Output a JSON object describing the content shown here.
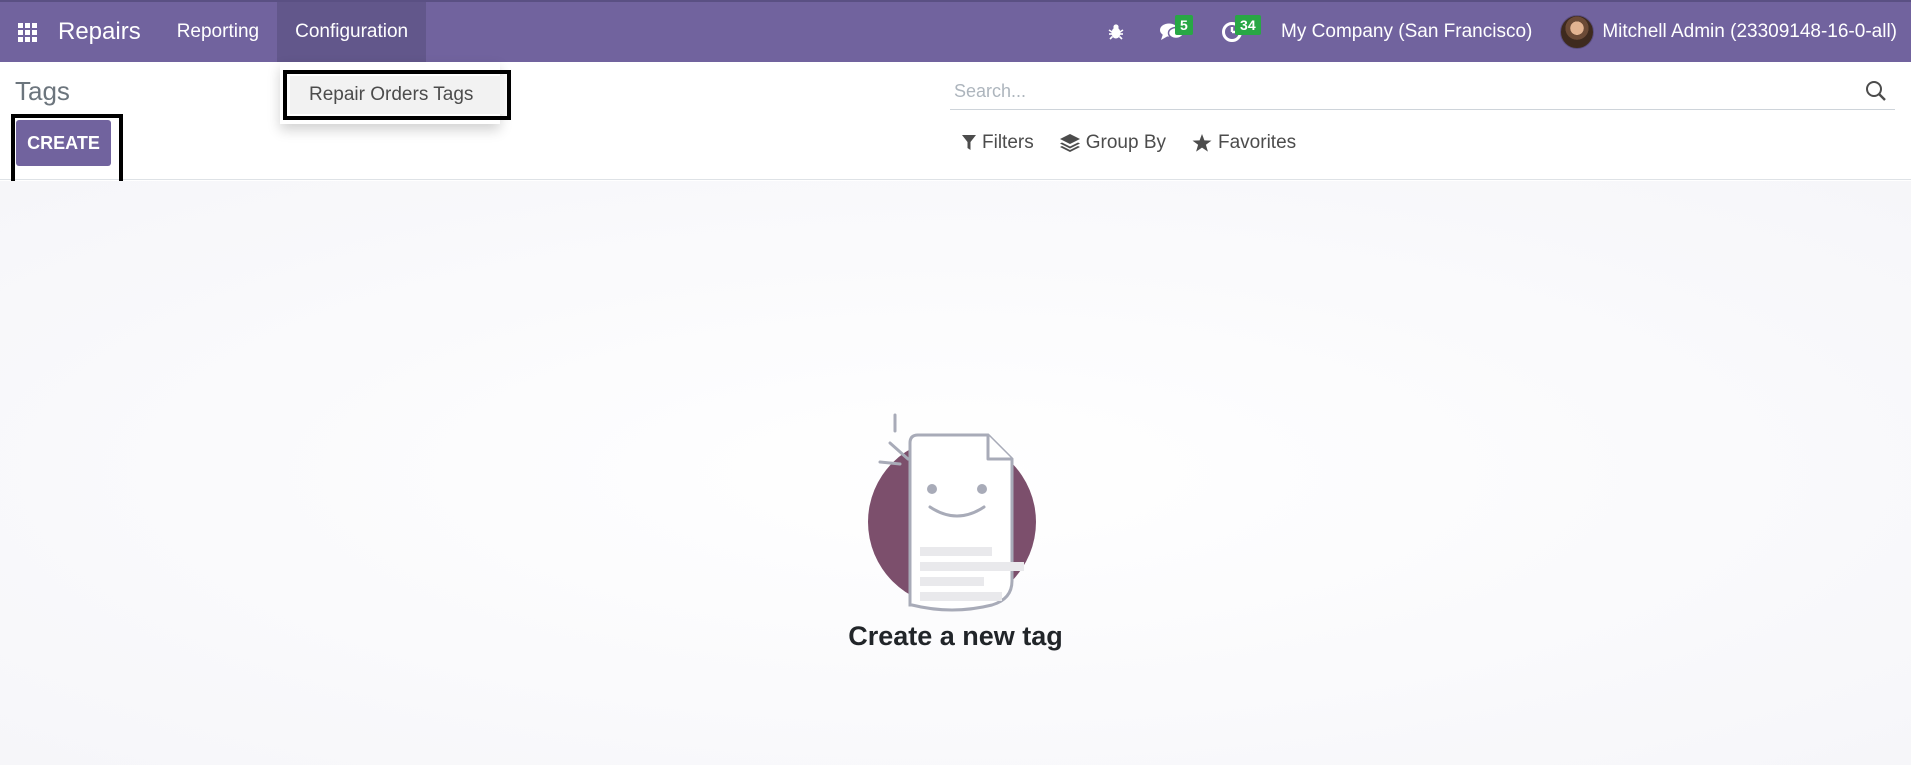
{
  "navbar": {
    "app_name": "Repairs",
    "menus": [
      {
        "label": "Reporting"
      },
      {
        "label": "Configuration"
      }
    ],
    "messages_badge": "5",
    "activities_badge": "34",
    "company": "My Company (San Francisco)",
    "user": "Mitchell Admin (23309148-16-0-all)",
    "accent_color": "#71639e",
    "badge_color": "#28a745"
  },
  "dropdown": {
    "items": [
      {
        "label": "Repair Orders Tags"
      }
    ]
  },
  "control_panel": {
    "breadcrumb": "Tags",
    "create_label": "CREATE",
    "search_placeholder": "Search...",
    "filters_label": "Filters",
    "group_by_label": "Group By",
    "favorites_label": "Favorites"
  },
  "help": {
    "title": "Create a new tag"
  },
  "icons": [
    "apps-grid-icon",
    "bug-icon",
    "messages-icon",
    "activity-clock-icon",
    "search-icon",
    "filter-icon",
    "layers-icon",
    "star-icon"
  ]
}
